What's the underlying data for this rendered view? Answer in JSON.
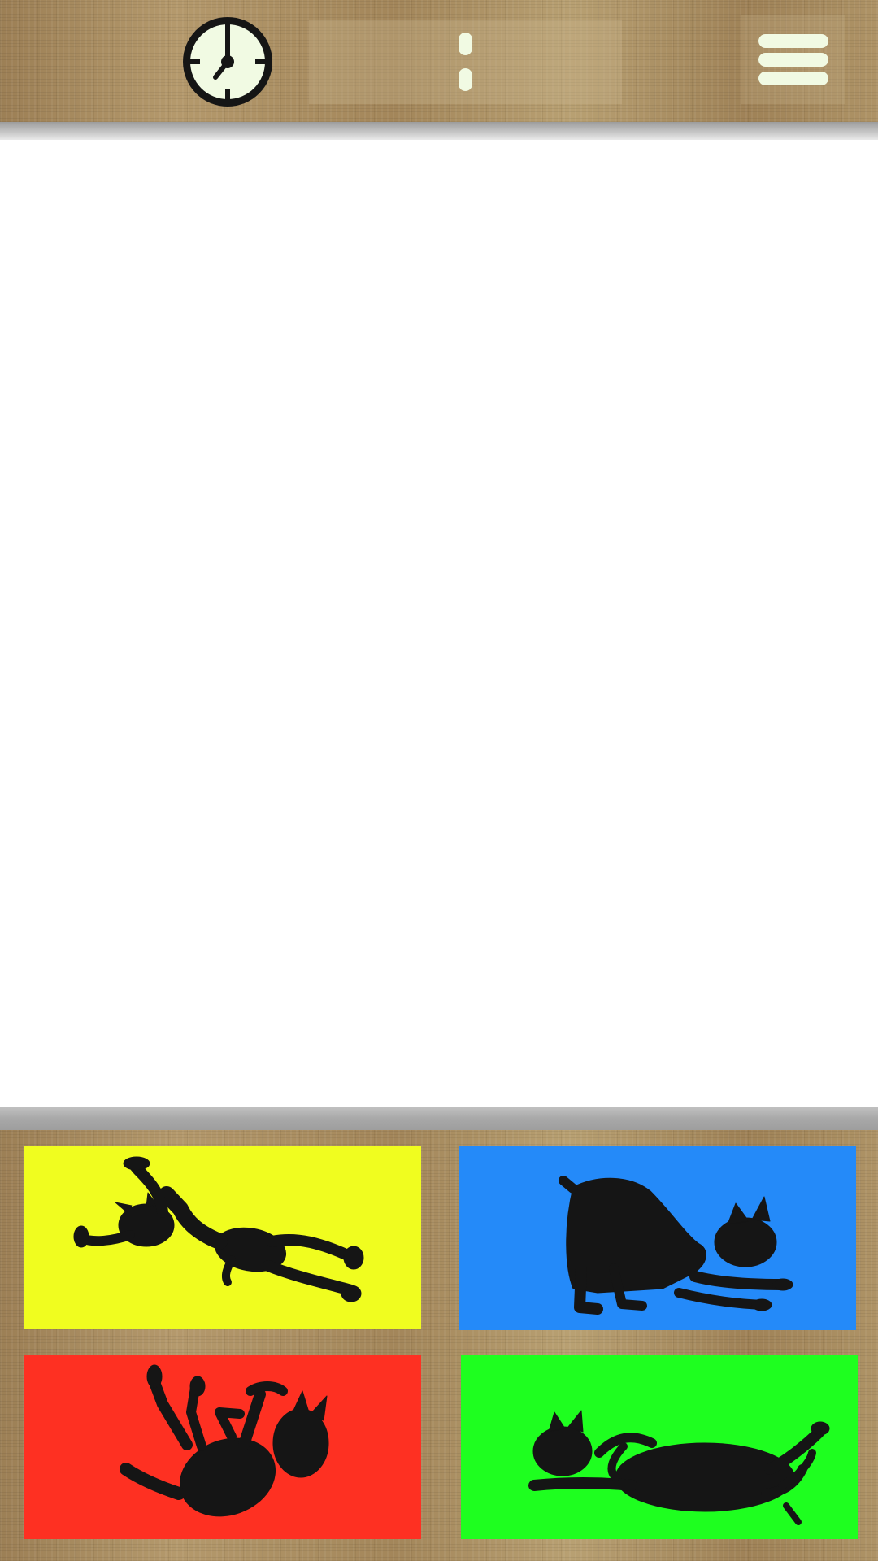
{
  "header": {
    "clock_icon": "clock-icon",
    "time_value": "",
    "separator": "colon",
    "menu_icon": "hamburger-menu-icon"
  },
  "colors": {
    "wood": "#a78b5f",
    "icon_light": "#f1fae3",
    "silhouette": "#151515",
    "yellow": "#f0fd1f",
    "blue": "#248af9",
    "red": "#fe3022",
    "green": "#1eff1f"
  },
  "answer_cards": [
    {
      "color": "yellow",
      "icon": "cat-leaping-icon"
    },
    {
      "color": "blue",
      "icon": "cat-stretching-icon"
    },
    {
      "color": "red",
      "icon": "cat-falling-icon"
    },
    {
      "color": "green",
      "icon": "cat-lying-icon"
    }
  ]
}
